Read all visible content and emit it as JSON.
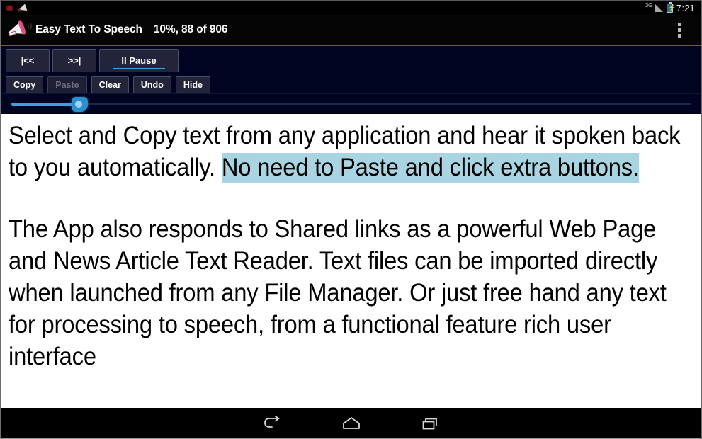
{
  "status_bar": {
    "notification_icons": [
      "alert-dot-icon",
      "megaphone-notification-icon"
    ],
    "network_label": "3G",
    "signal_icon": "signal-bars-icon",
    "battery_icon": "battery-charging-icon",
    "clock": "7:21"
  },
  "title_bar": {
    "app_icon": "megaphone-icon",
    "app_title": "Easy Text To Speech",
    "progress_text": "10%, 88 of 906",
    "overflow_icon": "overflow-menu-icon"
  },
  "controls": {
    "transport": [
      {
        "label": "|<<",
        "name": "rewind-button",
        "active": false
      },
      {
        "label": ">>|",
        "name": "forward-button",
        "active": false
      },
      {
        "label": "II Pause",
        "name": "pause-button",
        "active": true
      }
    ],
    "edit": [
      {
        "label": "Copy",
        "name": "copy-button",
        "disabled": false
      },
      {
        "label": "Paste",
        "name": "paste-button",
        "disabled": true
      },
      {
        "label": "Clear",
        "name": "clear-button",
        "disabled": false
      },
      {
        "label": "Undo",
        "name": "undo-button",
        "disabled": false
      },
      {
        "label": "Hide",
        "name": "hide-button",
        "disabled": false
      }
    ],
    "slider": {
      "name": "playback-progress-slider",
      "value_percent": 10,
      "accent_color": "#3d9fdc"
    }
  },
  "content": {
    "paragraph_1_pre": "Select and Copy text from any application and hear it spoken back to you automatically. ",
    "paragraph_1_highlight": "No need to Paste and click extra buttons.",
    "paragraph_2": "The App also responds to Shared links as a powerful Web Page and News Article Text Reader. Text files can be imported directly when launched from any File Manager. Or just free hand any text for processing to speech, from a functional feature rich user interface",
    "highlight_color": "#a9d5e3"
  },
  "nav_bar": {
    "items": [
      {
        "name": "back-button",
        "icon": "back-arrow-icon"
      },
      {
        "name": "home-button",
        "icon": "home-icon"
      },
      {
        "name": "recents-button",
        "icon": "recent-apps-icon"
      }
    ]
  }
}
